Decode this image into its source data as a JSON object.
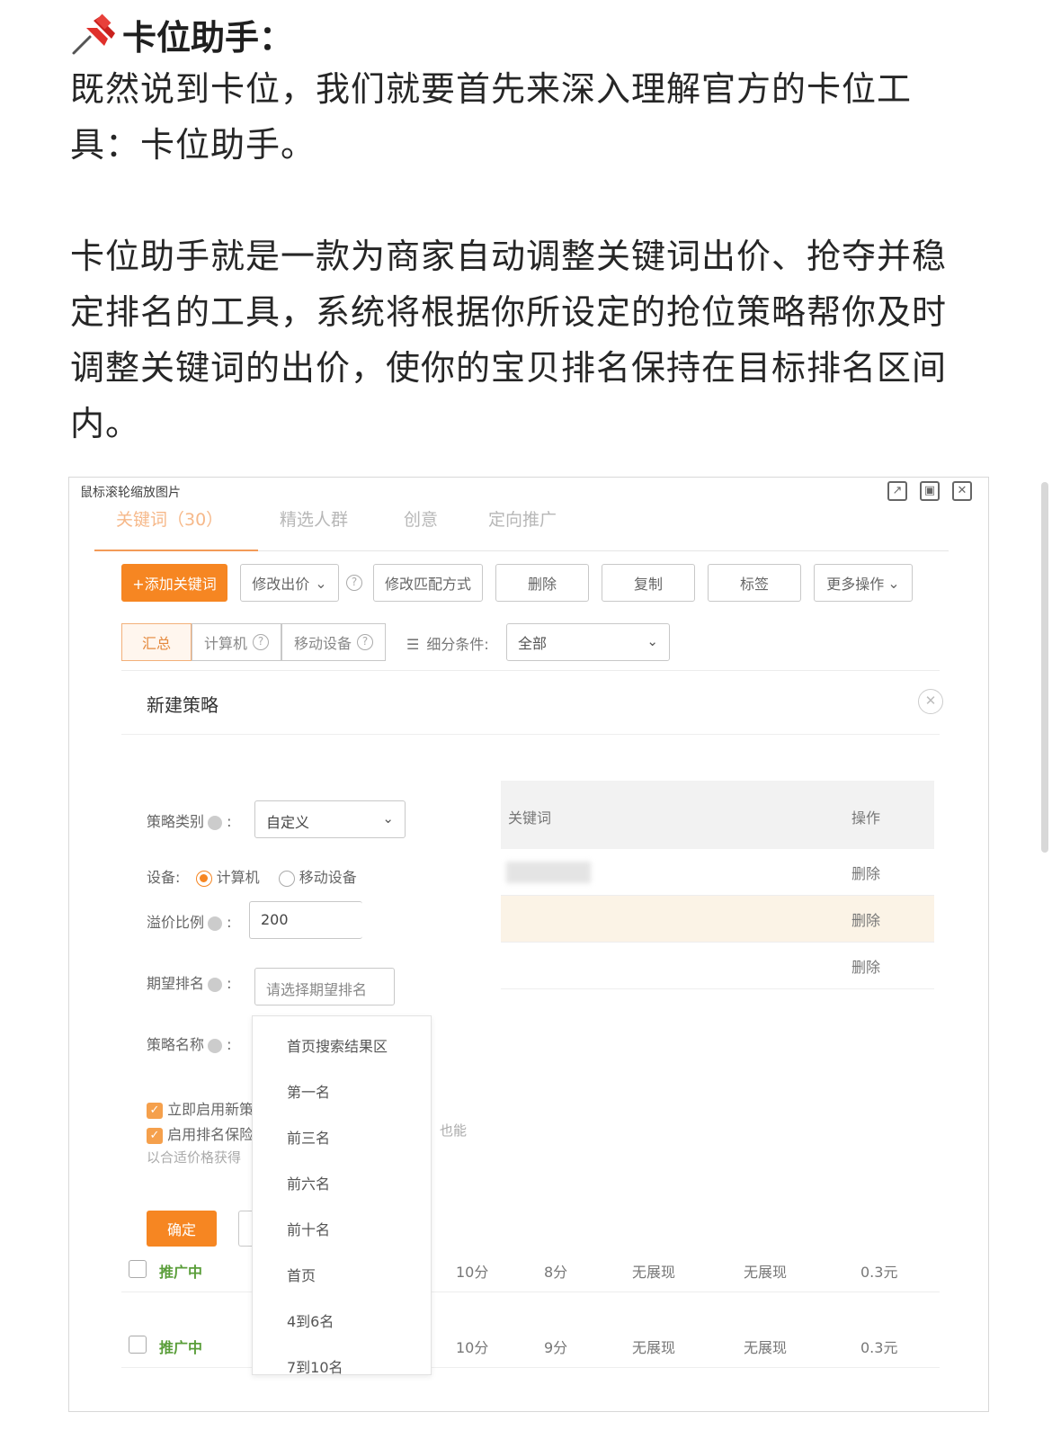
{
  "article": {
    "heading": "卡位助手：",
    "paragraphs": [
      "既然说到卡位，我们就要首先来深入理解官方的卡位工具：卡位助手。",
      "卡位助手就是一款为商家自动调整关键词出价、抢夺并稳定排名的工具，系统将根据你所设定的抢位策略帮你及时调整关键词的出价，使你的宝贝排名保持在目标排名区间内。"
    ]
  },
  "screenshot": {
    "hint": "鼠标滚轮缩放图片",
    "tabs": [
      "关键词（30）",
      "精选人群",
      "创意",
      "定向推广"
    ],
    "toolbar": {
      "add_keyword": "+添加关键词",
      "modify_bid": "修改出价",
      "modify_match": "修改匹配方式",
      "delete": "删除",
      "copy": "复制",
      "tag": "标签",
      "more": "更多操作"
    },
    "segments": [
      "汇总",
      "计算机",
      "移动设备"
    ],
    "filter": {
      "label": "细分条件:",
      "value": "全部"
    },
    "dialog": {
      "title": "新建策略",
      "strategy_type_label": "策略类别",
      "strategy_type_value": "自定义",
      "device_label": "设备:",
      "device_options": [
        "计算机",
        "移动设备"
      ],
      "premium_label": "溢价比例",
      "premium_value": "200",
      "expected_rank_label": "期望排名",
      "expected_rank_placeholder": "请选择期望排名",
      "strategy_name_label": "策略名称",
      "enable_now": "立即启用新策",
      "enable_protect": "启用排名保险",
      "note": "以合适价格获得",
      "note_tail": "也能",
      "confirm": "确定",
      "keyword_col": "关键词",
      "action_col": "操作",
      "delete_label": "删除",
      "rank_options": [
        "首页搜索结果区",
        "第一名",
        "前三名",
        "前六名",
        "前十名",
        "首页",
        "4到6名",
        "7到10名"
      ]
    },
    "rows": [
      {
        "status": "推广中",
        "c1": "10分",
        "c2": "8分",
        "c3": "无展现",
        "c4": "无展现",
        "c5": "0.3元"
      },
      {
        "status": "推广中",
        "c1": "10分",
        "c2": "9分",
        "c3": "无展现",
        "c4": "无展现",
        "c5": "0.3元"
      }
    ]
  },
  "colors": {
    "accent": "#f68622",
    "status_green": "#5a9e3a"
  },
  "icons": [
    "pushpin-icon",
    "external-link-icon",
    "minimize-icon",
    "close-icon",
    "chevron-down-icon",
    "help-icon",
    "list-icon"
  ]
}
